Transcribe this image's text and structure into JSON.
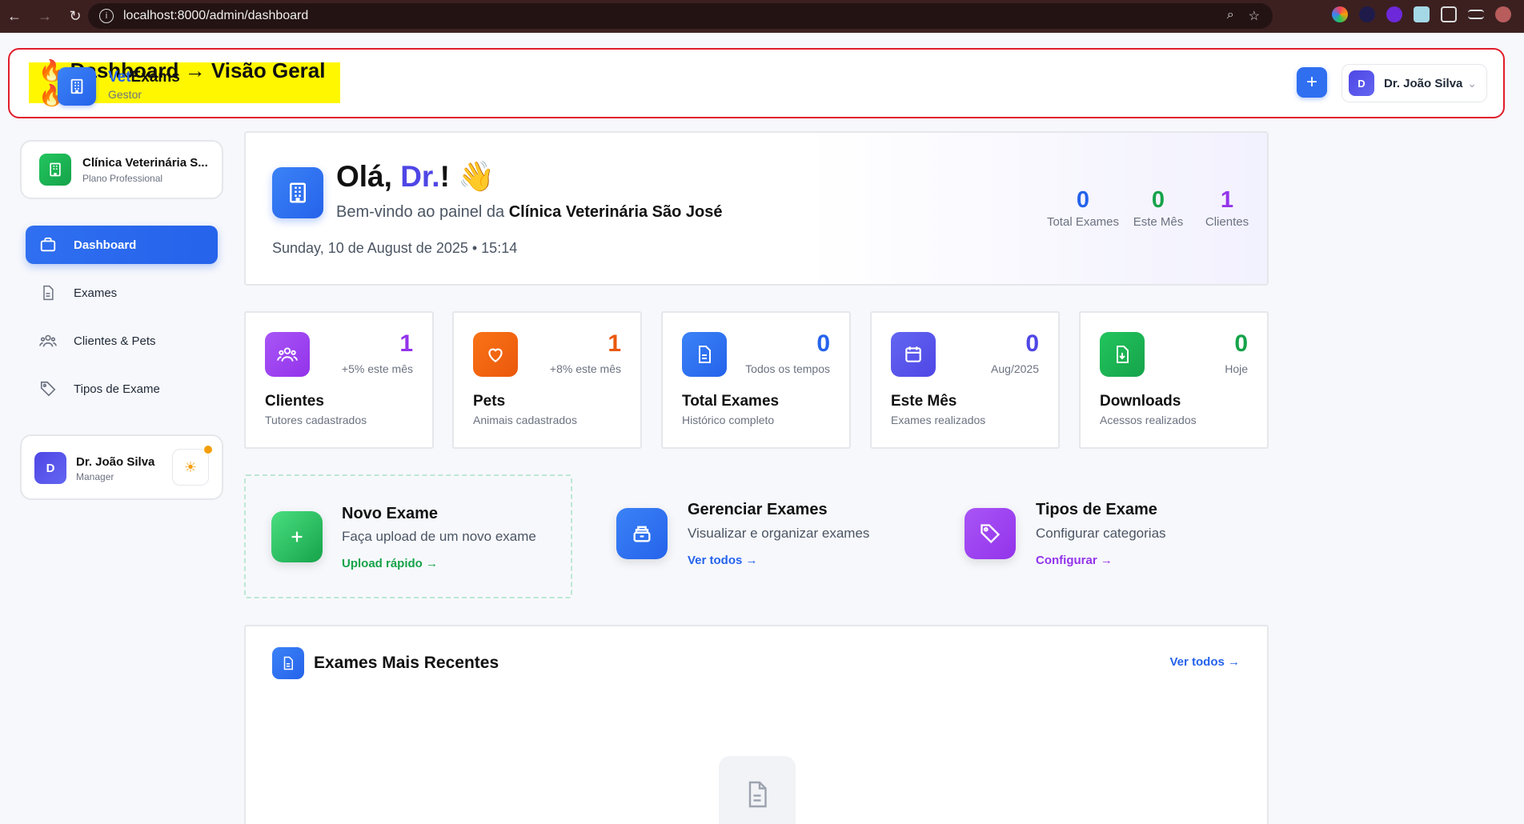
{
  "browser": {
    "url": "localhost:8000/admin/dashboard",
    "back_icon": "arrow-left-icon",
    "forward_icon": "arrow-right-icon",
    "reload_icon": "reload-icon"
  },
  "header": {
    "overlay_title": "🔥 Dashboard → Visão Geral 🔥",
    "brand_prefix": "Vet",
    "brand_suffix": "Exams",
    "brand_role": "Gestor",
    "add_button_label": "+",
    "user_avatar": "D",
    "user_name": "Dr. João Silva"
  },
  "sidebar": {
    "clinic_name": "Clínica Veterinária S...",
    "clinic_plan": "Plano Professional",
    "items": [
      {
        "label": "Dashboard",
        "icon": "briefcase-icon",
        "active": true
      },
      {
        "label": "Exames",
        "icon": "document-icon",
        "active": false
      },
      {
        "label": "Clientes & Pets",
        "icon": "users-icon",
        "active": false
      },
      {
        "label": "Tipos de Exame",
        "icon": "tag-icon",
        "active": false
      }
    ],
    "user": {
      "avatar": "D",
      "name": "Dr. João Silva",
      "role": "Manager",
      "theme_icon": "☀"
    }
  },
  "welcome": {
    "greeting_prefix": "Olá, ",
    "greeting_name": "Dr.",
    "greeting_suffix": "! 👋",
    "subtitle_prefix": "Bem-vindo ao painel da ",
    "clinic": "Clínica Veterinária São José",
    "datetime": "Sunday, 10 de August de 2025 • 15:14",
    "stats": [
      {
        "value": "0",
        "label": "Total Exames",
        "color": "#2563eb"
      },
      {
        "value": "0",
        "label": "Este Mês",
        "color": "#16a34a"
      },
      {
        "value": "1",
        "label": "Clientes",
        "color": "#9333ea"
      }
    ]
  },
  "stat_cards": [
    {
      "value": "1",
      "note": "+5% este mês",
      "title": "Clientes",
      "desc": "Tutores cadastrados",
      "color": "#9333ea",
      "icon": "users-icon"
    },
    {
      "value": "1",
      "note": "+8% este mês",
      "title": "Pets",
      "desc": "Animais cadastrados",
      "color": "#ea580c",
      "icon": "heart-icon"
    },
    {
      "value": "0",
      "note": "Todos os tempos",
      "title": "Total Exames",
      "desc": "Histórico completo",
      "color": "#2563eb",
      "icon": "document-icon"
    },
    {
      "value": "0",
      "note": "Aug/2025",
      "title": "Este Mês",
      "desc": "Exames realizados",
      "color": "#4f46e5",
      "icon": "calendar-icon"
    },
    {
      "value": "0",
      "note": "Hoje",
      "title": "Downloads",
      "desc": "Acessos realizados",
      "color": "#16a34a",
      "icon": "download-icon"
    }
  ],
  "quick_actions": [
    {
      "title": "Novo Exame",
      "desc": "Faça upload de um novo exame",
      "link": "Upload rápido →",
      "color": "#16a34a",
      "icon": "plus-icon"
    },
    {
      "title": "Gerenciar Exames",
      "desc": "Visualizar e organizar exames",
      "link": "Ver todos →",
      "color": "#2563eb",
      "icon": "archive-icon"
    },
    {
      "title": "Tipos de Exame",
      "desc": "Configurar categorias",
      "link": "Configurar →",
      "color": "#9333ea",
      "icon": "tag-icon"
    }
  ],
  "recent": {
    "title": "Exames Mais Recentes",
    "link": "Ver todos →",
    "empty_icon": "document-icon"
  }
}
